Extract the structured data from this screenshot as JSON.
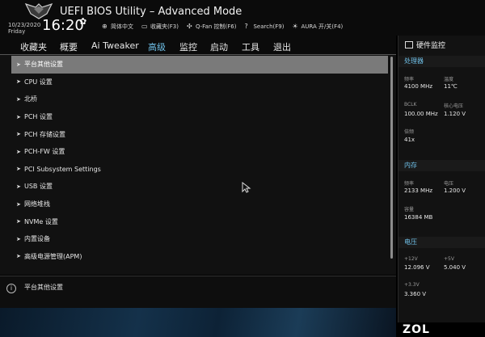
{
  "header": {
    "title": "UEFI BIOS Utility – Advanced Mode",
    "date": "10/23/2020",
    "weekday": "Friday",
    "time": "16:20",
    "quick_items": [
      {
        "icon": "globe-icon",
        "label": "简体中文"
      },
      {
        "icon": "favorites-icon",
        "label": "收藏夹(F3)"
      },
      {
        "icon": "fan-icon",
        "label": "Q-Fan 控制(F6)"
      },
      {
        "icon": "question-icon",
        "label": "Search(F9)"
      },
      {
        "icon": "aura-icon",
        "label": "AURA 开/关(F4)"
      }
    ]
  },
  "nav": {
    "tabs": [
      {
        "label": "收藏夹",
        "active": false
      },
      {
        "label": "概要",
        "active": false
      },
      {
        "label": "Ai Tweaker",
        "active": false
      },
      {
        "label": "高级",
        "active": true
      },
      {
        "label": "监控",
        "active": false
      },
      {
        "label": "启动",
        "active": false
      },
      {
        "label": "工具",
        "active": false
      },
      {
        "label": "退出",
        "active": false
      }
    ]
  },
  "menu": {
    "items": [
      {
        "label": "平台其他设置",
        "selected": true
      },
      {
        "label": "CPU 设置",
        "selected": false
      },
      {
        "label": "北桥",
        "selected": false
      },
      {
        "label": "PCH 设置",
        "selected": false
      },
      {
        "label": "PCH 存储设置",
        "selected": false
      },
      {
        "label": "PCH-FW 设置",
        "selected": false
      },
      {
        "label": "PCI Subsystem Settings",
        "selected": false
      },
      {
        "label": "USB 设置",
        "selected": false
      },
      {
        "label": "网络堆栈",
        "selected": false
      },
      {
        "label": "NVMe 设置",
        "selected": false
      },
      {
        "label": "内置设备",
        "selected": false
      },
      {
        "label": "高级电源管理(APM)",
        "selected": false
      }
    ]
  },
  "help": {
    "text": "平台其他设置"
  },
  "hardware_monitor": {
    "title": "硬件监控",
    "cpu": {
      "section": "处理器",
      "freq_label": "频率",
      "freq_value": "4100 MHz",
      "temp_label": "温度",
      "temp_value": "11℃",
      "bclk_label": "BCLK",
      "bclk_value": "100.00 MHz",
      "core_v_label": "核心电压",
      "core_v_value": "1.120 V",
      "ratio_label": "倍频",
      "ratio_value": "41x"
    },
    "memory": {
      "section": "内存",
      "freq_label": "频率",
      "freq_value": "2133 MHz",
      "volt_label": "电压",
      "volt_value": "1.200 V",
      "cap_label": "容量",
      "cap_value": "16384 MB"
    },
    "voltage": {
      "section": "电压",
      "v12_label": "+12V",
      "v12_value": "12.096 V",
      "v5_label": "+5V",
      "v5_value": "5.040 V",
      "v33_label": "+3.3V",
      "v33_value": "3.360 V"
    }
  },
  "watermark": "ZOL",
  "colors": {
    "accent": "#6fc0e8",
    "selected_row": "#7a7a7a",
    "background": "#111111"
  }
}
